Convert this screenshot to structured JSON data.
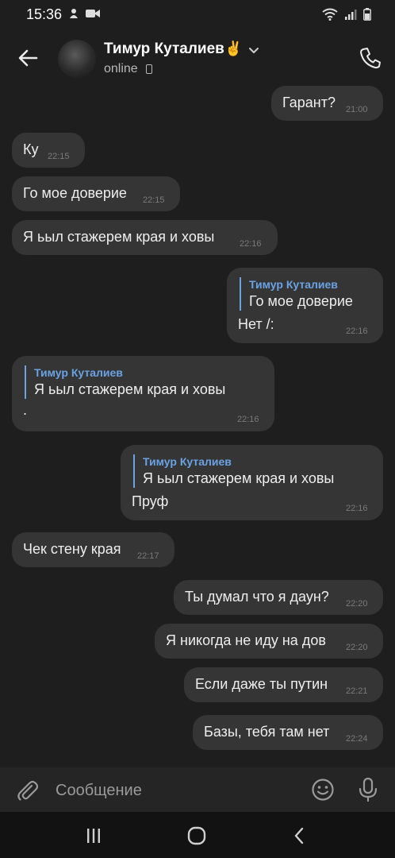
{
  "status_bar": {
    "time": "15:36"
  },
  "header": {
    "contact_name": "Тимур Куталиев",
    "name_emoji": "✌",
    "status": "online"
  },
  "messages": [
    {
      "side": "out",
      "text": "Гарант?",
      "time": "21:00"
    },
    {
      "side": "in",
      "text": "Ку",
      "time": "22:15"
    },
    {
      "side": "in",
      "text": "Го мое доверие",
      "time": "22:15"
    },
    {
      "side": "in",
      "text": "Я ьыл стажерем края и ховы",
      "time": "22:16"
    },
    {
      "side": "out",
      "reply_name": "Тимур Куталиев",
      "reply_text": "Го мое доверие",
      "text": "Нет /:",
      "time": "22:16"
    },
    {
      "side": "in",
      "reply_name": "Тимур Куталиев",
      "reply_text": "Я ьыл стажерем края и ховы",
      "text": ".",
      "time": "22:16"
    },
    {
      "side": "out",
      "reply_name": "Тимур Куталиев",
      "reply_text": "Я ьыл стажерем края и ховы",
      "text": "Пруф",
      "time": "22:16"
    },
    {
      "side": "in",
      "text": "Чек стену края",
      "time": "22:17"
    },
    {
      "side": "out",
      "text": "Ты думал что я даун?",
      "time": "22:20"
    },
    {
      "side": "out",
      "text": "Я никогда не иду на дов",
      "time": "22:20"
    },
    {
      "side": "out",
      "text": "Если даже ты путин",
      "time": "22:21"
    },
    {
      "side": "out",
      "text": "Базы, тебя там нет",
      "time": "22:24"
    }
  ],
  "composer": {
    "placeholder": "Сообщение"
  },
  "colors": {
    "background": "#1e1e1e",
    "bubble": "#353535",
    "reply_accent": "#6aa2e4"
  },
  "icons": [
    "back-arrow-icon",
    "chevron-down-icon",
    "phone-icon",
    "paperclip-icon",
    "emoji-icon",
    "microphone-icon",
    "recents-icon",
    "home-icon",
    "nav-back-icon"
  ]
}
